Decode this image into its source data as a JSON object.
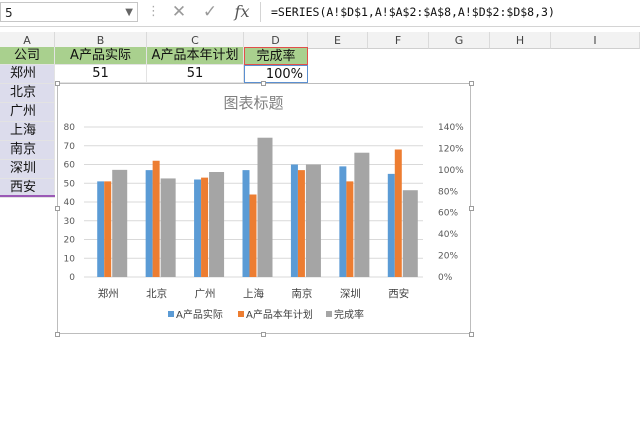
{
  "namebox": {
    "value": "5"
  },
  "formula": {
    "text": "=SERIES(A!$D$1,A!$A$2:$A$8,A!$D$2:$D$8,3)",
    "fx_label": "fx"
  },
  "columns": [
    "A",
    "B",
    "C",
    "D",
    "E",
    "F",
    "G",
    "H",
    "I"
  ],
  "sheet": {
    "headers": [
      "公司",
      "A产品实际",
      "A产品本年计划",
      "完成率"
    ],
    "first_row": {
      "company": "郑州",
      "actual": "51",
      "plan": "51",
      "rate": "100%"
    },
    "companies": [
      "郑州",
      "北京",
      "广州",
      "上海",
      "南京",
      "深圳",
      "西安"
    ]
  },
  "colors": {
    "actual": "#5b9bd5",
    "plan": "#ed7d31",
    "rate": "#a5a5a5",
    "header_fill": "#a9d08e",
    "row_label_fill": "#dcdcec"
  },
  "chart_data": {
    "type": "bar",
    "title": "图表标题",
    "categories": [
      "郑州",
      "北京",
      "广州",
      "上海",
      "南京",
      "深圳",
      "西安"
    ],
    "series": [
      {
        "name": "A产品实际",
        "axis": "left",
        "values": [
          51,
          57,
          52,
          57,
          60,
          59,
          55
        ]
      },
      {
        "name": "A产品本年计划",
        "axis": "left",
        "values": [
          51,
          62,
          53,
          44,
          57,
          51,
          68
        ]
      },
      {
        "name": "完成率",
        "axis": "right",
        "values": [
          1.0,
          0.92,
          0.98,
          1.3,
          1.05,
          1.16,
          0.81
        ]
      }
    ],
    "ylim": [
      0,
      80
    ],
    "yticks": [
      "0",
      "10",
      "20",
      "30",
      "40",
      "50",
      "60",
      "70",
      "80"
    ],
    "y2lim": [
      0,
      1.4
    ],
    "y2ticks": [
      "0%",
      "20%",
      "40%",
      "60%",
      "80%",
      "100%",
      "120%",
      "140%"
    ],
    "grid": true,
    "legend": "bottom"
  }
}
